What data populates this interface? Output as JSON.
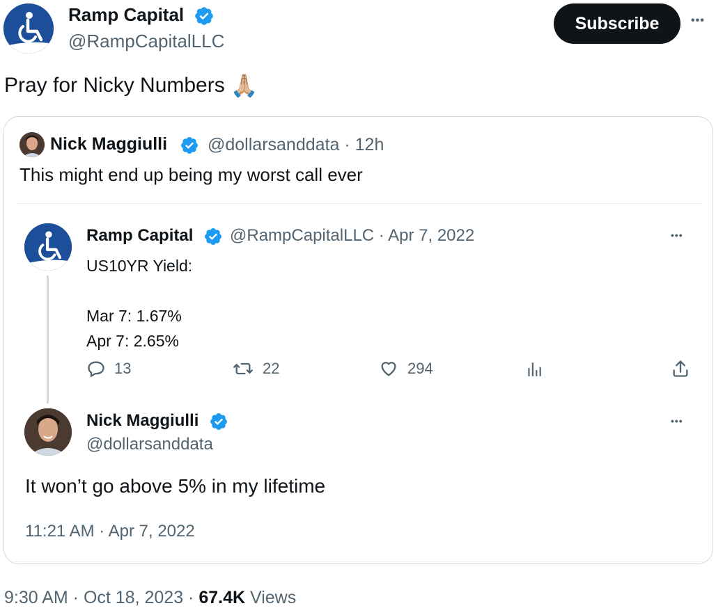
{
  "header": {
    "display_name": "Ramp Capital",
    "handle": "@RampCapitalLLC",
    "subscribe_label": "Subscribe",
    "more_label": "•••"
  },
  "tweet": {
    "text": "Pray for Nicky Numbers",
    "emoji": "🙏🏼"
  },
  "quote": {
    "author": {
      "display_name": "Nick Maggiulli",
      "handle": "@dollarsanddata",
      "time": "· 12h"
    },
    "text": "This might end up being my worst call ever",
    "embedded": {
      "first": {
        "display_name": "Ramp Capital",
        "handle": "@RampCapitalLLC",
        "date": "· Apr 7, 2022",
        "line1": "US10YR Yield:",
        "line2": "Mar 7: 1.67%",
        "line3": "Apr 7: 2.65%",
        "replies": "13",
        "retweets": "22",
        "likes": "294"
      },
      "second": {
        "display_name": "Nick Maggiulli",
        "handle": "@dollarsanddata",
        "text": "It won’t go above 5% in my lifetime",
        "timestamp": "11:21 AM · Apr 7, 2022"
      }
    }
  },
  "footer": {
    "timestamp": "9:30 AM · Oct 18, 2023 ·",
    "views_count": "67.4K",
    "views_label": "Views"
  },
  "colors": {
    "verified": "#1d9bf0",
    "logo_bg": "#1d4e9a",
    "muted": "#536471"
  }
}
